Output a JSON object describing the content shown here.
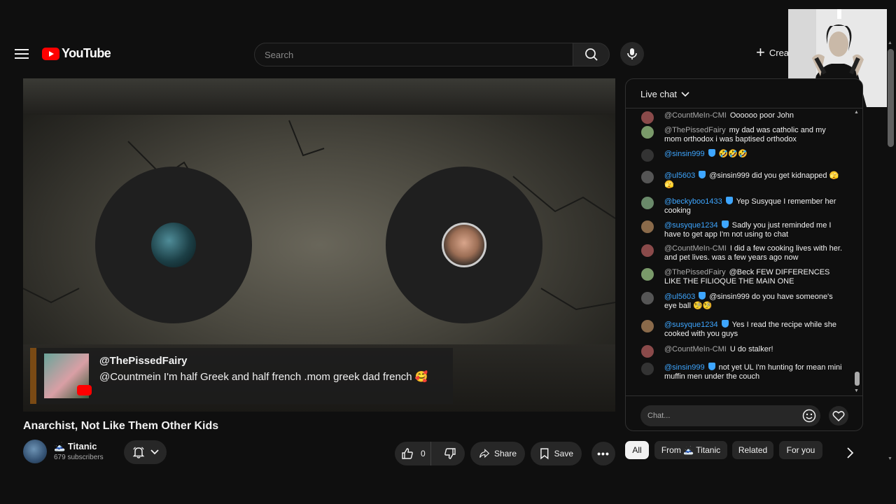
{
  "header": {
    "logo_text": "YouTube",
    "search_placeholder": "Search",
    "create_label": "Create"
  },
  "player": {
    "overlay": {
      "author": "@ThePissedFairy",
      "message": "@Countmein I'm half Greek and half french .mom greek dad french 🥰"
    }
  },
  "video": {
    "title": "Anarchist, Not Like Them Other Kids",
    "channel_name": "Titanic",
    "channel_icon": "🗻",
    "subscribers": "679 subscribers",
    "like_count": "0",
    "share_label": "Share",
    "save_label": "Save"
  },
  "chat": {
    "title": "Live chat",
    "input_placeholder": "Chat...",
    "messages": [
      {
        "author": "@CountMeIn-CMI",
        "member": false,
        "text": "Oooooo poor John",
        "avatar_color": "#8a4a4a"
      },
      {
        "author": "@ThePissedFairy",
        "member": false,
        "text": "my dad was catholic and my mom orthodox i was baptised orthodox",
        "avatar_color": "#7a9a6a"
      },
      {
        "author": "@sinsin999",
        "member": true,
        "text": "🤣🤣🤣",
        "avatar_color": "#333333"
      },
      {
        "author": "@ul5603",
        "member": true,
        "text": "@sinsin999 did you get kidnapped 🫣🫣",
        "avatar_color": "#555555"
      },
      {
        "author": "@beckyboo1433",
        "member": true,
        "text": "Yep Susyque I remember her cooking",
        "avatar_color": "#6a8a6a"
      },
      {
        "author": "@susyque1234",
        "member": true,
        "text": "Sadly you just reminded me I have to get app I'm not using to chat",
        "avatar_color": "#8a6a4a"
      },
      {
        "author": "@CountMeIn-CMI",
        "member": false,
        "text": "I did a few cooking lives with her. and pet lives. was a few years ago now",
        "avatar_color": "#8a4a4a"
      },
      {
        "author": "@ThePissedFairy",
        "member": false,
        "text": "@Beck FEW DIFFERENCES LIKE THE FILIOQUE THE MAIN ONE",
        "avatar_color": "#7a9a6a"
      },
      {
        "author": "@ul5603",
        "member": true,
        "text": "@sinsin999 do you have someone's eye ball 🧐🧐",
        "avatar_color": "#555555"
      },
      {
        "author": "@susyque1234",
        "member": true,
        "text": "Yes I read the recipe while she cooked with you guys",
        "avatar_color": "#8a6a4a"
      },
      {
        "author": "@CountMeIn-CMI",
        "member": false,
        "text": "U do stalker!",
        "avatar_color": "#8a4a4a"
      },
      {
        "author": "@sinsin999",
        "member": true,
        "text": "not yet UL I'm hunting for mean mini muffin men under the couch",
        "avatar_color": "#333333"
      }
    ]
  },
  "chips": [
    {
      "label": "All",
      "active": true
    },
    {
      "label": "From 🗻 Titanic",
      "active": false
    },
    {
      "label": "Related",
      "active": false
    },
    {
      "label": "For you",
      "active": false
    }
  ],
  "colors": {
    "background": "#0f0f0f",
    "brand_red": "#ff0000",
    "member_blue": "#3ea6ff",
    "surface": "#272727"
  },
  "icons": [
    "menu-icon",
    "youtube-logo-icon",
    "search-icon",
    "mic-icon",
    "plus-icon",
    "bell-icon",
    "chevron-down-icon",
    "thumbs-up-icon",
    "thumbs-down-icon",
    "share-icon",
    "save-icon",
    "more-icon",
    "emoji-icon",
    "heart-icon",
    "chevron-right-icon"
  ]
}
